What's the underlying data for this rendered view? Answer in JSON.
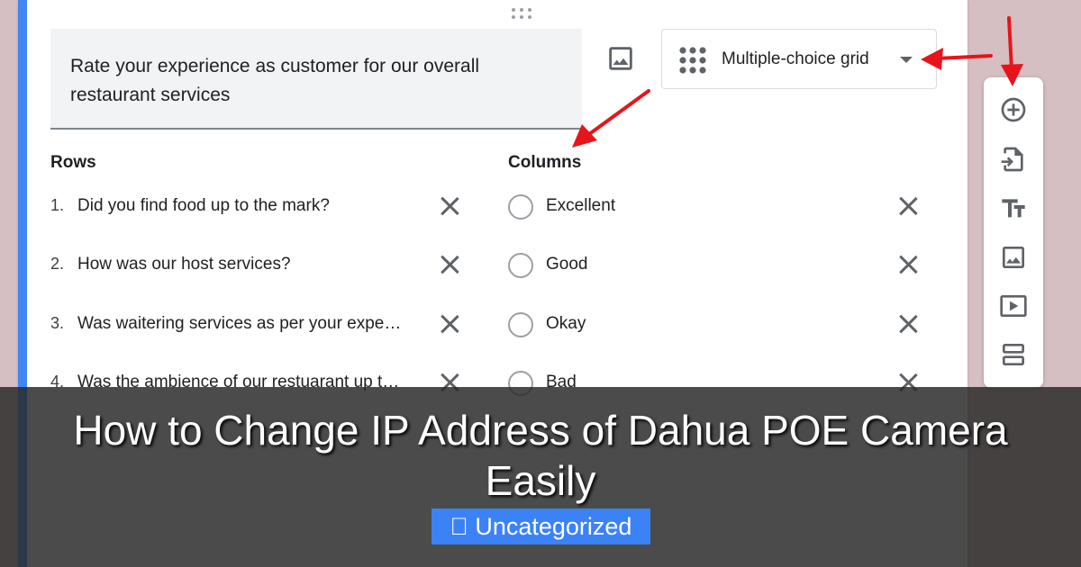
{
  "question": {
    "title": "Rate your experience as customer for our overall restaurant services",
    "type": "Multiple-choice grid"
  },
  "rows": {
    "heading": "Rows",
    "items": [
      {
        "num": "1.",
        "text": "Did you find food up to the mark?"
      },
      {
        "num": "2.",
        "text": "How was our host services?"
      },
      {
        "num": "3.",
        "text": "Was waitering services as per your expe…"
      },
      {
        "num": "4.",
        "text": "Was the ambience of our restuarant up t…"
      }
    ]
  },
  "columns": {
    "heading": "Columns",
    "items": [
      "Excellent",
      "Good",
      "Okay",
      "Bad"
    ]
  },
  "toolbar": {
    "icons": [
      "add-question-icon",
      "import-questions-icon",
      "add-title-icon",
      "add-image-icon",
      "add-video-icon",
      "add-section-icon"
    ]
  },
  "banner": {
    "title": "How to Change IP Address of Dahua POE Camera Easily",
    "category": " Uncategorized"
  },
  "colors": {
    "accent": "#4285f4",
    "arrow": "#e8141b",
    "badge": "#3b82f6"
  }
}
